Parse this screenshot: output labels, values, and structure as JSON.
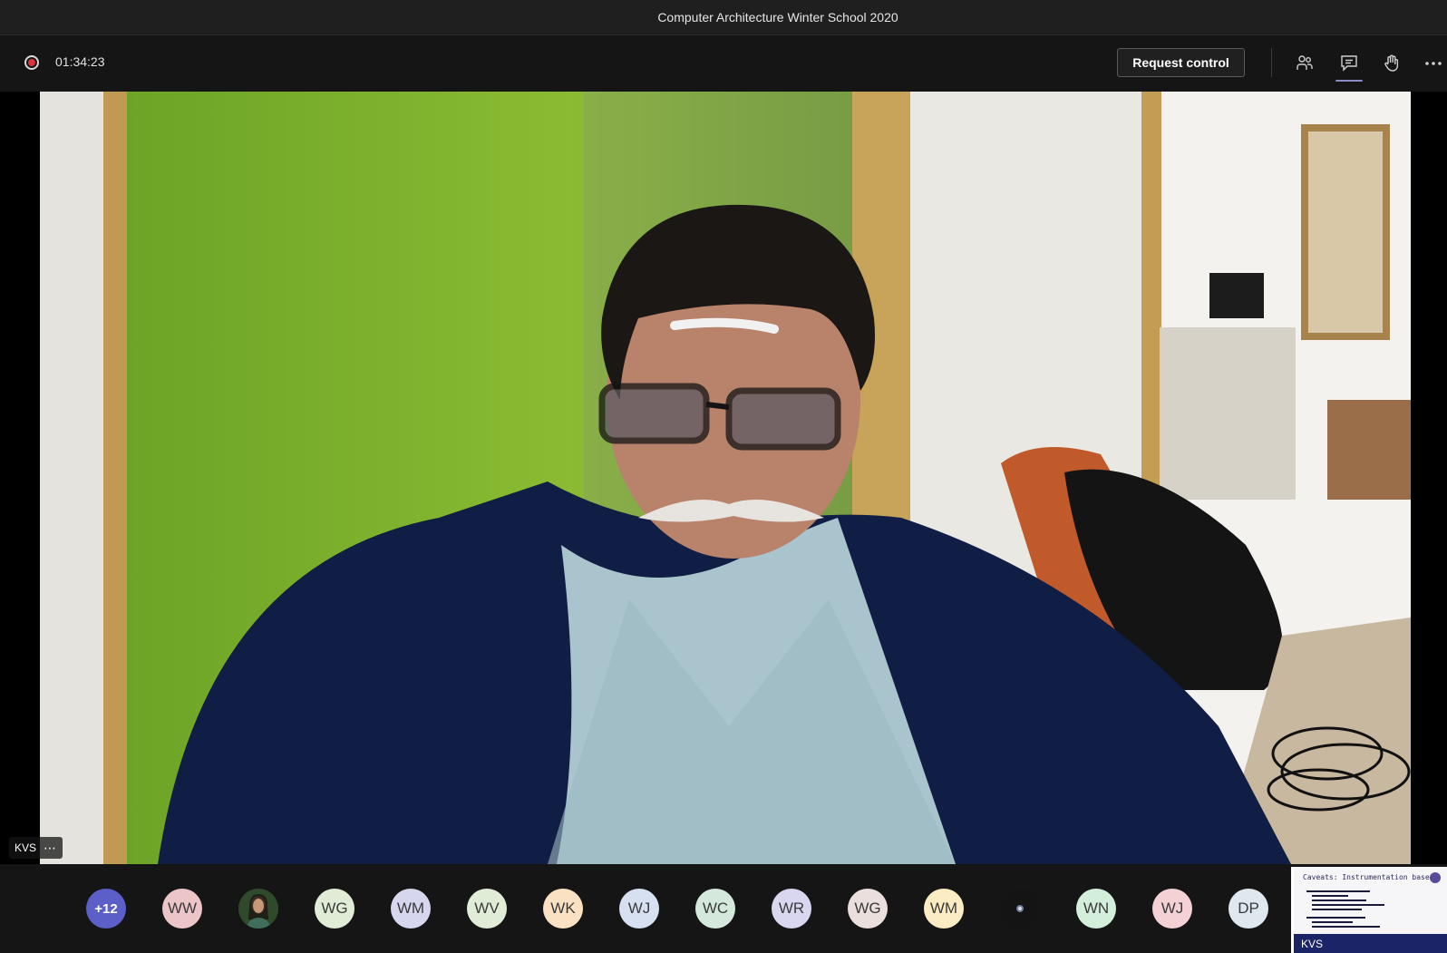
{
  "window": {
    "title": "Computer Architecture Winter School 2020"
  },
  "call": {
    "recording_timer": "01:34:23",
    "request_control_label": "Request control"
  },
  "toolbar": {
    "icons": [
      "people-icon",
      "chat-icon",
      "raise-hand-icon",
      "more-options-icon"
    ],
    "accent": "#8b8cc7"
  },
  "video": {
    "speaker_name": "KVS",
    "more_label": "⋯"
  },
  "participants": {
    "overflow_label": "+12",
    "avatars": [
      {
        "initials": "WW",
        "color": "#ecc5c8"
      },
      {
        "initials": "",
        "color": "#2a3b2a",
        "photo": true
      },
      {
        "initials": "WG",
        "color": "#e1ecd6"
      },
      {
        "initials": "WM",
        "color": "#d7d6ef"
      },
      {
        "initials": "WV",
        "color": "#e1ecd6"
      },
      {
        "initials": "WK",
        "color": "#fbe1c4"
      },
      {
        "initials": "WJ",
        "color": "#d6e0f0"
      },
      {
        "initials": "WC",
        "color": "#d4e9dc"
      },
      {
        "initials": "WR",
        "color": "#d9d6ef"
      },
      {
        "initials": "WG",
        "color": "#eadfdc"
      },
      {
        "initials": "WM",
        "color": "#fbecc4"
      },
      {
        "initials": "",
        "color": "#202020",
        "photo": true
      },
      {
        "initials": "WN",
        "color": "#d4eedc"
      },
      {
        "initials": "WJ",
        "color": "#f3d1d5"
      },
      {
        "initials": "DP",
        "color": "#dfe8ee"
      }
    ]
  },
  "screen_share": {
    "label": "KVS",
    "slide_title": "Caveats: Instrumentation based"
  }
}
